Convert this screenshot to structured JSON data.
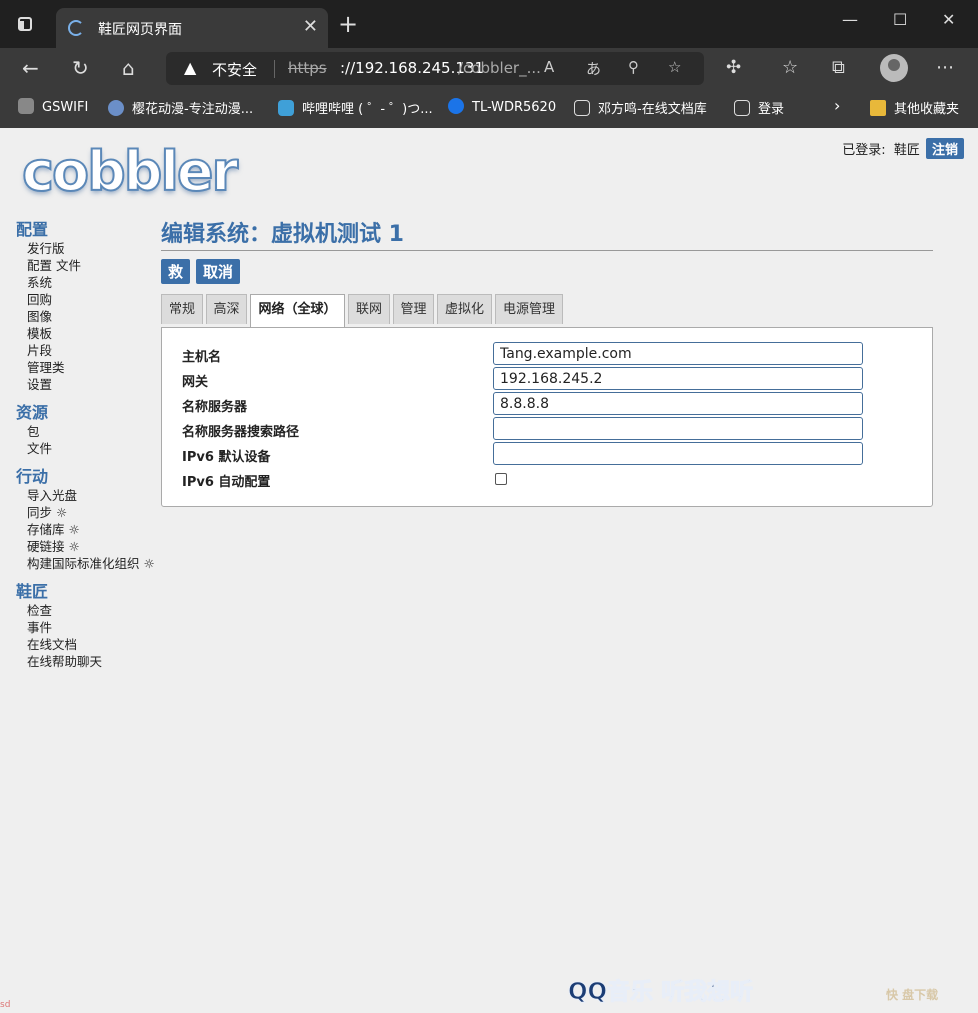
{
  "browser": {
    "tab_title": "鞋匠网页界面",
    "address": {
      "insecure_label": "不安全",
      "scheme": "https",
      "host": "://192.168.245.131",
      "path": "/cobbler_..."
    },
    "bookmarks": [
      "GSWIFI",
      "樱花动漫-专注动漫...",
      "哔哩哔哩 ( ゜- ゜)つ...",
      "TL-WDR5620",
      "邓方鸣-在线文档库",
      "登录",
      "其他收藏夹"
    ]
  },
  "header": {
    "logo_text": "cobbler",
    "logged_in_label": "已登录:",
    "username": "鞋匠",
    "logout_label": "注销"
  },
  "sidebar": {
    "sections": [
      {
        "title": "配置",
        "items": [
          "发行版",
          "配置 文件",
          "系统",
          "回购",
          "图像",
          "模板",
          "片段",
          "管理类",
          "设置"
        ]
      },
      {
        "title": "资源",
        "items": [
          "包",
          "文件"
        ]
      },
      {
        "title": "行动",
        "items": [
          "导入光盘",
          "同步 ☼",
          "存储库 ☼",
          "硬链接 ☼",
          "构建国际标准化组织 ☼"
        ]
      },
      {
        "title": "鞋匠",
        "items": [
          "检查",
          "事件",
          "在线文档",
          "在线帮助聊天"
        ]
      }
    ]
  },
  "main": {
    "title": "编辑系统：虚拟机测试 1",
    "save_label": "救",
    "cancel_label": "取消",
    "tabs": [
      "常规",
      "高深",
      "网络（全球）",
      "联网",
      "管理",
      "虚拟化",
      "电源管理"
    ],
    "active_tab": 2,
    "fields": [
      {
        "label": "主机名",
        "value": "Tang.example.com"
      },
      {
        "label": "网关",
        "value": "192.168.245.2"
      },
      {
        "label": "名称服务器",
        "value": "8.8.8.8"
      },
      {
        "label": "名称服务器搜索路径",
        "value": ""
      },
      {
        "label": "IPv6 默认设备",
        "value": ""
      }
    ],
    "checkbox_label": "IPv6 自动配置",
    "checkbox_checked": false
  },
  "watermarks": {
    "music": "QQ音乐 听我想听",
    "site": "快 盘下载",
    "corner": "sd"
  }
}
